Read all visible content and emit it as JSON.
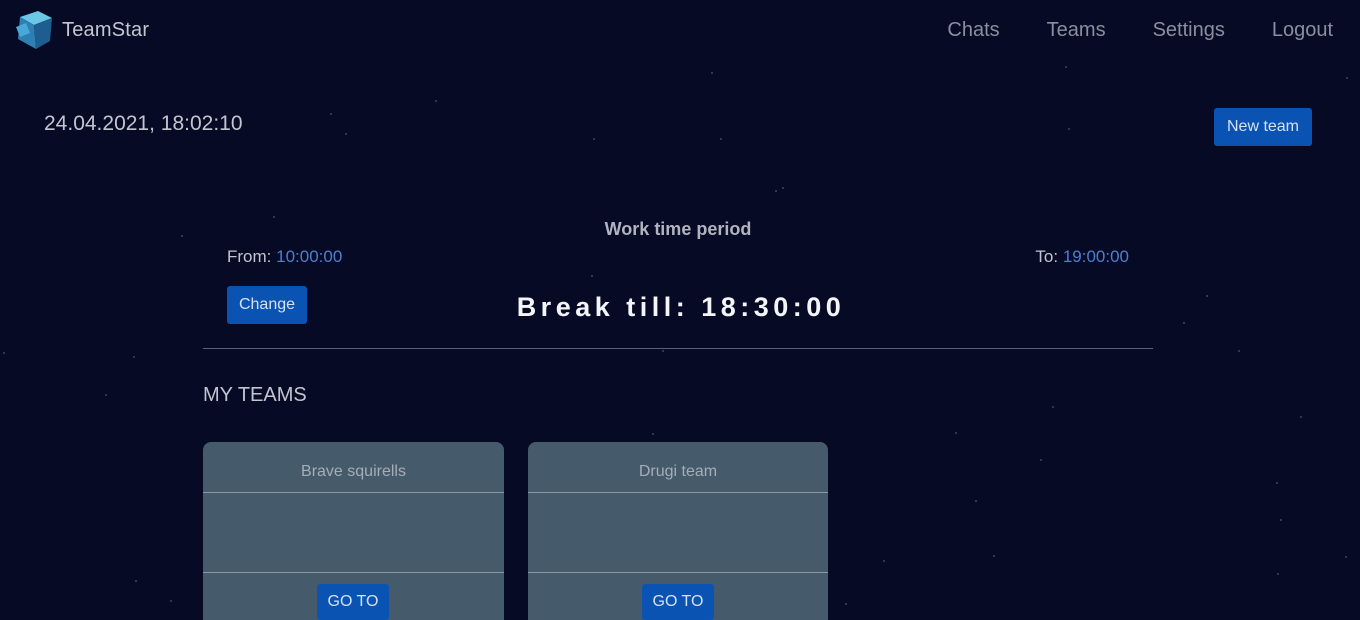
{
  "app": {
    "name": "TeamStar"
  },
  "nav": {
    "links": [
      {
        "label": "Chats"
      },
      {
        "label": "Teams"
      },
      {
        "label": "Settings"
      },
      {
        "label": "Logout"
      }
    ]
  },
  "header": {
    "datetime": "24.04.2021, 18:02:10"
  },
  "actions": {
    "new_team_label": "New team"
  },
  "work_time": {
    "title": "Work time period",
    "from_label": "From:",
    "from_value": "10:00:00",
    "to_label": "To:",
    "to_value": "19:00:00",
    "change_label": "Change",
    "break_text": "Break till: 18:30:00"
  },
  "my_teams": {
    "heading": "MY TEAMS",
    "teams": [
      {
        "name": "Brave squirells",
        "button_label": "GO TO"
      },
      {
        "name": "Drugi team",
        "button_label": "GO TO"
      }
    ]
  },
  "colors": {
    "background": "#060a25",
    "primary_button": "#0a53b3",
    "time_value": "#4c7fd1",
    "card": "#455a6b"
  }
}
